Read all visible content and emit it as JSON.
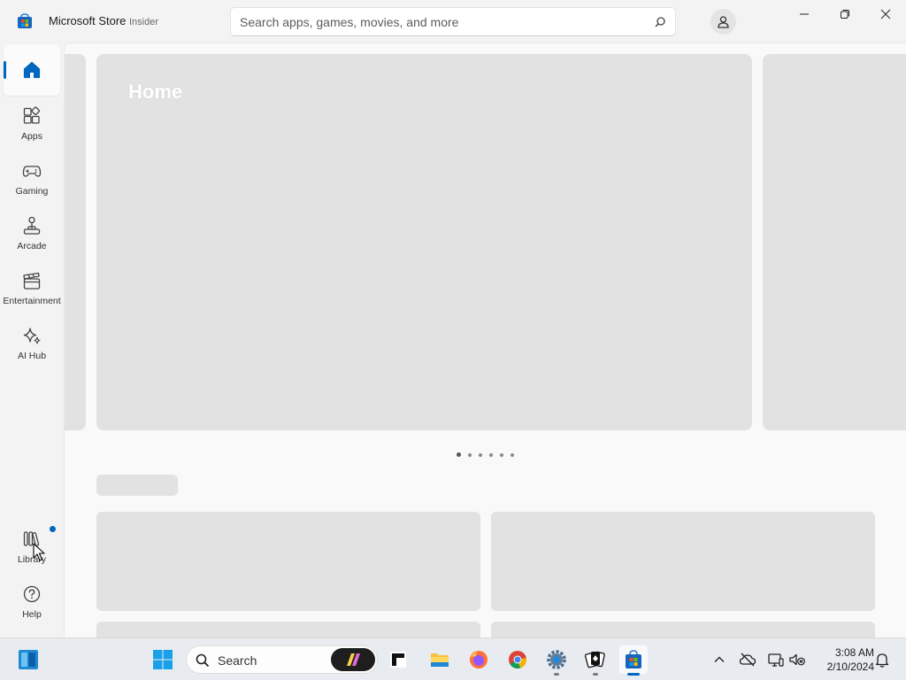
{
  "window": {
    "title": "Microsoft Store",
    "channel": "Insider"
  },
  "search": {
    "placeholder": "Search apps, games, movies, and more"
  },
  "sidebar": {
    "items": [
      {
        "label": "",
        "icon": "home-icon",
        "selected": true
      },
      {
        "label": "Apps",
        "icon": "apps-icon"
      },
      {
        "label": "Gaming",
        "icon": "gamepad-icon"
      },
      {
        "label": "Arcade",
        "icon": "joystick-icon"
      },
      {
        "label": "Entertainment",
        "icon": "clapperboard-icon"
      },
      {
        "label": "AI Hub",
        "icon": "sparkle-icon"
      },
      {
        "label": "Library",
        "icon": "library-icon",
        "has_notification": true
      },
      {
        "label": "Help",
        "icon": "help-icon"
      }
    ]
  },
  "hero": {
    "title": "Home",
    "page_count": 6
  },
  "taskbar": {
    "search_label": "Search",
    "apps": [
      "start",
      "search",
      "copilot",
      "terminal",
      "file-explorer",
      "firefox",
      "chrome",
      "settings",
      "solitaire",
      "microsoft-store"
    ]
  },
  "tray": {
    "time": "3:08 AM",
    "date": "2/10/2024"
  },
  "colors": {
    "accent": "#0067c0",
    "background": "#f3f3f3",
    "skeleton": "#e2e2e2"
  }
}
